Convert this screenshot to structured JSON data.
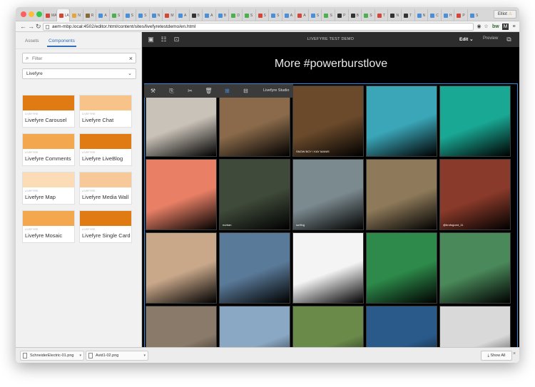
{
  "browser": {
    "profile_name": "Elliot",
    "tabs": [
      {
        "label": "MA",
        "color": "#d44638"
      },
      {
        "label": "LA",
        "color": "#d44638",
        "active": true
      },
      {
        "label": "N",
        "color": "#e8a33c"
      },
      {
        "label": "R",
        "color": "#8a6a3a"
      },
      {
        "label": "A",
        "color": "#4a8fd8"
      },
      {
        "label": "S",
        "color": "#4caf50"
      },
      {
        "label": "S",
        "color": "#4a8fd8"
      },
      {
        "label": "S",
        "color": "#4a8fd8"
      },
      {
        "label": "N",
        "color": "#4a8fd8"
      },
      {
        "label": "M",
        "color": "#d44638"
      },
      {
        "label": "A",
        "color": "#4a8fd8"
      },
      {
        "label": "B",
        "color": "#333333"
      },
      {
        "label": "A",
        "color": "#4a8fd8"
      },
      {
        "label": "B",
        "color": "#4a8fd8"
      },
      {
        "label": "D",
        "color": "#4caf50"
      },
      {
        "label": "S",
        "color": "#4caf50"
      },
      {
        "label": "S",
        "color": "#d44638"
      },
      {
        "label": "S",
        "color": "#4a8fd8"
      },
      {
        "label": "A",
        "color": "#4a8fd8"
      },
      {
        "label": "A",
        "color": "#d44638"
      },
      {
        "label": "S",
        "color": "#4a8fd8"
      },
      {
        "label": "S",
        "color": "#4caf50"
      },
      {
        "label": "P",
        "color": "#333333"
      },
      {
        "label": "B",
        "color": "#333333"
      },
      {
        "label": "S",
        "color": "#4caf50"
      },
      {
        "label": "T",
        "color": "#d44638"
      },
      {
        "label": "N",
        "color": "#333333"
      },
      {
        "label": "T",
        "color": "#333333"
      },
      {
        "label": "N",
        "color": "#4a8fd8"
      },
      {
        "label": "C",
        "color": "#4a8fd8"
      },
      {
        "label": "H",
        "color": "#4a8fd8"
      },
      {
        "label": "P",
        "color": "#d44638"
      },
      {
        "label": "S",
        "color": "#4a8fd8"
      }
    ],
    "url": "aem-mbp.local:4502/editor.html/content/sites/livefyretestdemo/en.html"
  },
  "sidebar": {
    "tabs": {
      "assets": "Assets",
      "components": "Components"
    },
    "filter_placeholder": "Filter",
    "group_select": "Livefyre",
    "components": [
      {
        "category": "LIVEFYRE",
        "name": "Livefyre Carousel",
        "color": "#e07a12"
      },
      {
        "category": "LIVEFYRE",
        "name": "Livefyre Chat",
        "color": "#f7c389"
      },
      {
        "category": "LIVEFYRE",
        "name": "Livefyre Comments",
        "color": "#f3a850"
      },
      {
        "category": "LIVEFYRE",
        "name": "Livefyre LiveBlog",
        "color": "#e07a12"
      },
      {
        "category": "LIVEFYRE",
        "name": "Livefyre Map",
        "color": "#fbdcb6"
      },
      {
        "category": "LIVEFYRE",
        "name": "Livefyre Media Wall",
        "color": "#f8c998"
      },
      {
        "category": "LIVEFYRE",
        "name": "Livefyre Mosaic",
        "color": "#f3a850"
      },
      {
        "category": "LIVEFYRE",
        "name": "Livefyre Single Card",
        "color": "#e07a12"
      }
    ]
  },
  "editor": {
    "page_title": "LIVEFYRE TEST DEMO",
    "mode_label": "Edit",
    "preview_label": "Preview",
    "heading": "More #powerburstlove",
    "component_label": "Livefyre Studio",
    "tiles": [
      {
        "color": "#c9c2b8"
      },
      {
        "color": "#8a6a4a"
      },
      {
        "color": "#6b4a2b",
        "caption": "SNOW BOY / KAY MANIS"
      },
      {
        "color": "#3aa6b8"
      },
      {
        "color": "#19a894"
      },
      {
        "color": "#e98066"
      },
      {
        "color": "#3f4a3a",
        "caption": "nurban"
      },
      {
        "color": "#7b8a8f",
        "caption": "surfing"
      },
      {
        "color": "#8e7a5a"
      },
      {
        "color": "#8a3a2a",
        "caption": "@brofogoed_11"
      },
      {
        "color": "#c9a88a"
      },
      {
        "color": "#5a7a99"
      },
      {
        "color": "#f4f4f4"
      },
      {
        "color": "#2d8a4a"
      },
      {
        "color": "#4a8a5a"
      },
      {
        "color": "#8a7a6a"
      },
      {
        "color": "#8aa8c4"
      },
      {
        "color": "#6a8a4a"
      },
      {
        "color": "#2a5a8a"
      },
      {
        "color": "#d9d9d9"
      }
    ]
  },
  "downloads": {
    "items": [
      {
        "name": "SchneiderElectric-01.png"
      },
      {
        "name": "Avid1-02.png"
      }
    ],
    "show_all": "Show All"
  }
}
